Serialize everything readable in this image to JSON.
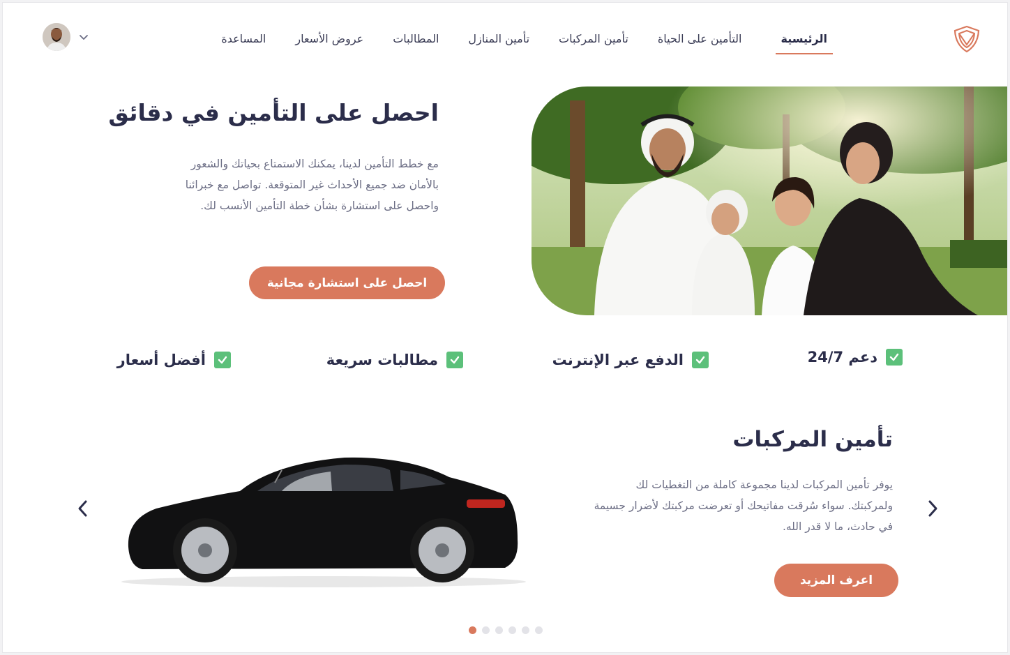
{
  "nav": {
    "items": [
      {
        "label": "الرئيسية",
        "active": true
      },
      {
        "label": "التأمين على الحياة"
      },
      {
        "label": "تأمين المركبات"
      },
      {
        "label": "تأمين المنازل"
      },
      {
        "label": "المطالبات"
      },
      {
        "label": "عروض الأسعار"
      },
      {
        "label": "المساعدة"
      }
    ]
  },
  "hero": {
    "title": "احصل على التأمين في دقائق",
    "description": "مع خطط التأمين لدينا، يمكنك الاستمتاع بحياتك والشعور بالأمان ضد جميع الأحداث غير المتوقعة. تواصل مع خبرائنا واحصل على استشارة بشأن خطة التأمين الأنسب لك.",
    "cta_label": "احصل على استشارة مجانية"
  },
  "features": [
    {
      "label": "دعم 24/7"
    },
    {
      "label": "الدفع عبر الإنترنت"
    },
    {
      "label": "مطالبات سريعة"
    },
    {
      "label": "أفضل أسعار"
    }
  ],
  "product": {
    "title": "تأمين المركبات",
    "description": "يوفر تأمين المركبات لدينا مجموعة كاملة من التغطيات لك ولمركبتك. سواء سُرقت مفاتيحك أو تعرضت مركبتك لأضرار جسيمة في حادث، ما لا قدر الله.",
    "more_label": "اعرف المزيد"
  },
  "carousel": {
    "total": 6,
    "active": 1
  },
  "colors": {
    "accent": "#d9795d",
    "check": "#5cc07a",
    "heading": "#2b2d4a",
    "body_text": "#6b6d84"
  },
  "icons": {
    "logo": "shield-logo-icon",
    "check": "check-icon",
    "prev": "chevron-left-icon",
    "next": "chevron-right-icon",
    "profile_menu": "chevron-down-icon"
  }
}
